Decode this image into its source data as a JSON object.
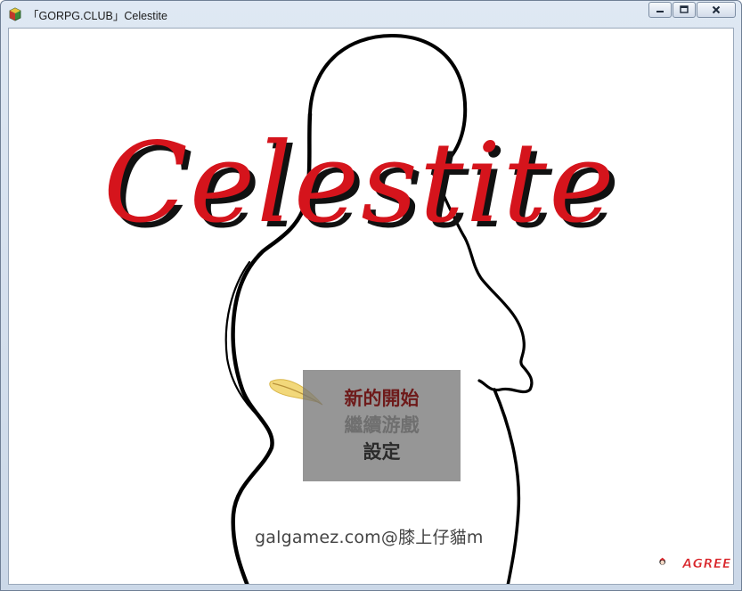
{
  "window": {
    "title": "「GORPG.CLUB」Celestite",
    "buttons": {
      "minimize": "minimize",
      "maximize": "maximize",
      "close": "close"
    }
  },
  "game": {
    "title": "Celestite",
    "menu": {
      "new_game": "新的開始",
      "continue": "繼續游戲",
      "settings": "設定"
    },
    "watermark": "galgamez.com@膝上仔貓m",
    "corner_logo": "AGREE"
  },
  "colors": {
    "title_red": "#d5141c",
    "title_shadow": "#111111",
    "menu_bg": "#787878",
    "menu_selected": "#6e1a1a",
    "menu_inactive": "#6f6f6f",
    "menu_active": "#2b2b2b"
  },
  "icons": {
    "app": "game-app-icon",
    "cursor": "feather-cursor-icon",
    "logo": "agree-mascot-logo"
  }
}
